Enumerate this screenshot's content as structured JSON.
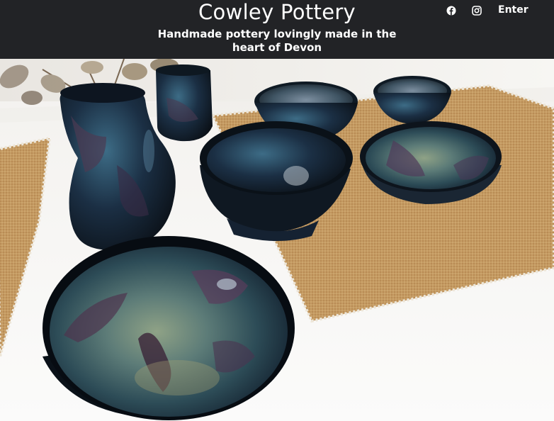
{
  "header": {
    "title": "Cowley Pottery",
    "tagline": "Handmade pottery lovingly made in the heart of Devon",
    "nav": {
      "facebook_icon": "facebook-icon",
      "instagram_icon": "instagram-icon",
      "enter_label": "Enter"
    }
  },
  "hero": {
    "subject": "photo-glazed-pottery-bowls-vase-on-table"
  },
  "colors": {
    "header_bg": "#222326",
    "header_text": "#ffffff"
  }
}
